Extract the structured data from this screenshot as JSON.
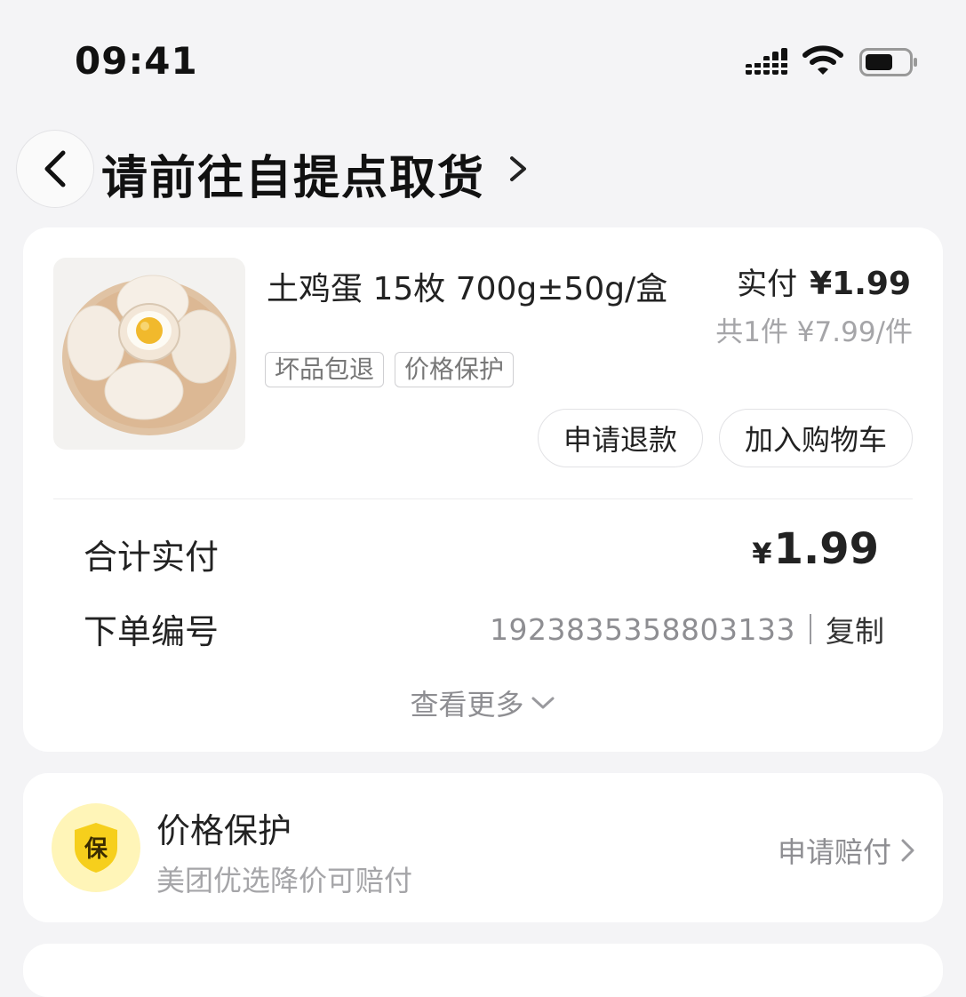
{
  "status_bar": {
    "time": "09:41"
  },
  "nav": {
    "title": "请前往自提点取货"
  },
  "order": {
    "product_name": "土鸡蛋 15枚 700g±50g/盒",
    "paid_label": "实付",
    "paid_amount": "¥1.99",
    "unit_info": "共1件 ¥7.99/件",
    "tags": [
      "坏品包退",
      "价格保护"
    ],
    "actions": {
      "refund": "申请退款",
      "add_to_cart": "加入购物车"
    },
    "total_label": "合计实付",
    "total_currency": "¥",
    "total_value": "1.99",
    "order_no_label": "下单编号",
    "order_no": "1923835358803133",
    "copy_label": "复制",
    "see_more": "查看更多"
  },
  "price_protection": {
    "badge": "保",
    "title": "价格保护",
    "subtitle": "美团优选降价可赔付",
    "claim": "申请赔付"
  },
  "colors": {
    "badge_bg": "#fff5b8",
    "badge_shield": "#f6cf1c"
  }
}
